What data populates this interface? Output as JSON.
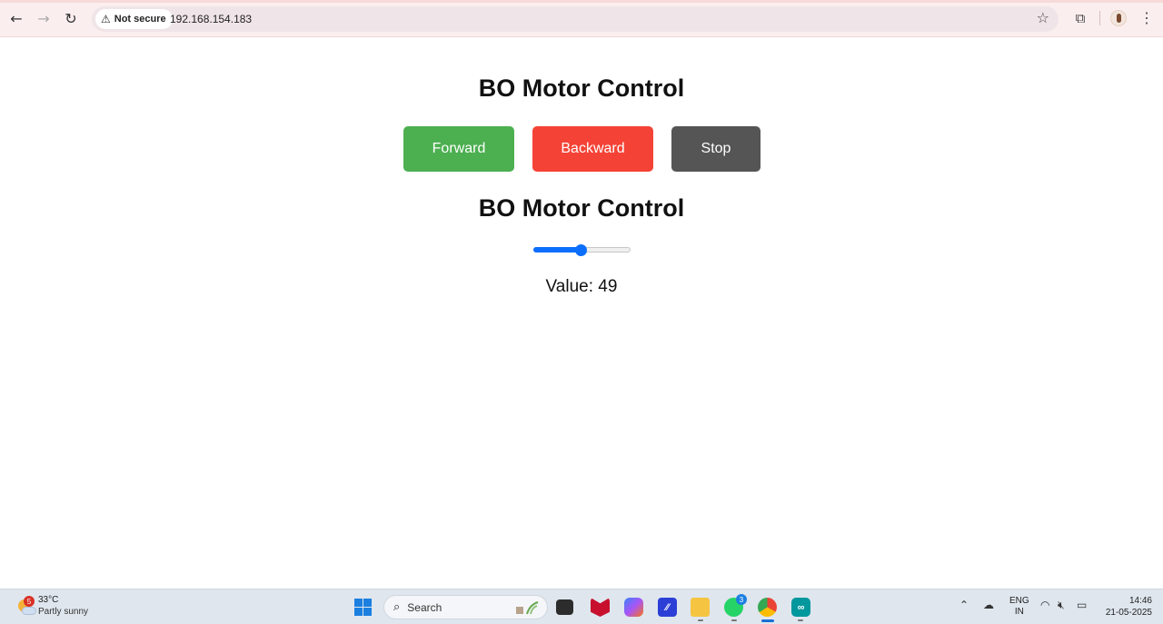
{
  "browser": {
    "security_label": "Not secure",
    "url": "192.168.154.183"
  },
  "page": {
    "title_1": "BO Motor Control",
    "title_2": "BO Motor Control",
    "buttons": {
      "forward": "Forward",
      "backward": "Backward",
      "stop": "Stop"
    },
    "slider": {
      "min": 0,
      "max": 100,
      "value": 49
    },
    "value_label": "Value: 49"
  },
  "colors": {
    "forward": "#4caf50",
    "backward": "#f44336",
    "stop": "#555555",
    "slider_accent": "#0b6efd"
  },
  "taskbar": {
    "weather_temp": "33°C",
    "weather_condition": "Partly sunny",
    "weather_badge": "5",
    "search_label": "Search",
    "whatsapp_badge": "3",
    "lang_primary": "ENG",
    "lang_region": "IN",
    "time": "14:46",
    "date": "21-05-2025"
  }
}
